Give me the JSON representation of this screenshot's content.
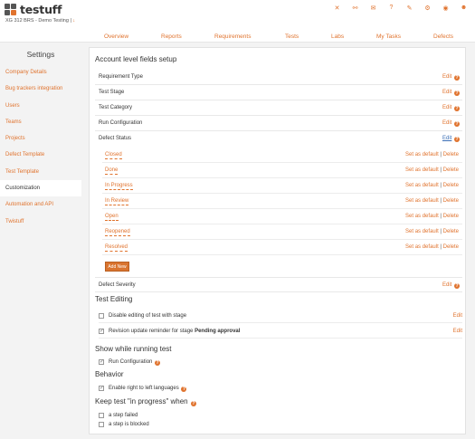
{
  "app": {
    "name": "testuff",
    "project": "XG 312 BRS - Demo Testing",
    "project_arrow": "↓",
    "header_icons": [
      "close-icon",
      "link-icon",
      "mail-icon",
      "help-icon",
      "wrench-icon",
      "settings-icon",
      "eye-icon",
      "user-icon"
    ]
  },
  "nav": {
    "items": [
      "Overview",
      "Reports",
      "Requirements",
      "Tests",
      "Labs",
      "My Tasks",
      "Defects"
    ]
  },
  "sidebar": {
    "title": "Settings",
    "items": [
      "Company Details",
      "Bug trackers integration",
      "Users",
      "Teams",
      "Projects",
      "Defect Template",
      "Test Template",
      "Customization",
      "Automation and API",
      "Twistuff"
    ],
    "active": "Customization"
  },
  "account_fields": {
    "title": "Account level fields setup",
    "rows": [
      "Requirement Type",
      "Test Stage",
      "Test Category",
      "Run Configuration",
      "Defect Status"
    ],
    "edit_label": "Edit",
    "statuses": [
      "Closed",
      "Done",
      "In Progress",
      "In Review",
      "Open",
      "Reopened",
      "Resolved"
    ],
    "set_default_label": "Set as default",
    "separator": "|",
    "delete_label": "Delete",
    "add_new_label": "Add New",
    "after_row": "Defect Severity"
  },
  "test_editing": {
    "title": "Test Editing",
    "items": [
      {
        "label": "Disable editing of test with stage",
        "strong": "",
        "checked": false,
        "edit": "Edit"
      },
      {
        "label": "Revision update reminder for stage ",
        "strong": "Pending approval",
        "checked": true,
        "edit": "Edit"
      }
    ]
  },
  "running": {
    "title": "Show while running test",
    "item": "Run Configuration",
    "checked": true
  },
  "behavior": {
    "title": "Behavior",
    "item": "Enable right to left languages",
    "checked": true
  },
  "in_progress": {
    "title": "Keep test \"in progress\" when",
    "items": [
      "a step failed",
      "a step is blocked"
    ]
  },
  "colors": {
    "accent": "#e0732e",
    "button": "#d9742f",
    "background": "#f3f3f3"
  }
}
